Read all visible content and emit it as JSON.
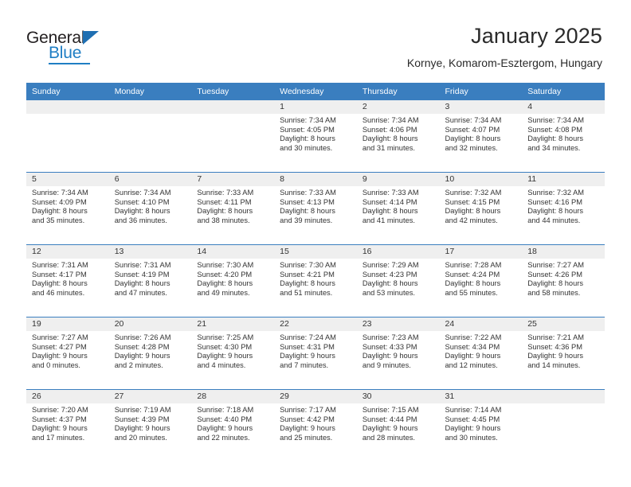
{
  "logo": {
    "word_general": "General",
    "word_blue": "Blue",
    "triangle_color": "#1f6fb2",
    "blue_color": "#1f7ec4"
  },
  "header": {
    "title": "January 2025",
    "subtitle": "Kornye, Komarom-Esztergom, Hungary",
    "header_bg": "#3a7ebf",
    "daynum_bg": "#efefef"
  },
  "weekday_headers": [
    "Sunday",
    "Monday",
    "Tuesday",
    "Wednesday",
    "Thursday",
    "Friday",
    "Saturday"
  ],
  "weeks": [
    [
      {
        "empty": true
      },
      {
        "empty": true
      },
      {
        "empty": true
      },
      {
        "day": "1",
        "sunrise": "Sunrise: 7:34 AM",
        "sunset": "Sunset: 4:05 PM",
        "daylight1": "Daylight: 8 hours",
        "daylight2": "and 30 minutes."
      },
      {
        "day": "2",
        "sunrise": "Sunrise: 7:34 AM",
        "sunset": "Sunset: 4:06 PM",
        "daylight1": "Daylight: 8 hours",
        "daylight2": "and 31 minutes."
      },
      {
        "day": "3",
        "sunrise": "Sunrise: 7:34 AM",
        "sunset": "Sunset: 4:07 PM",
        "daylight1": "Daylight: 8 hours",
        "daylight2": "and 32 minutes."
      },
      {
        "day": "4",
        "sunrise": "Sunrise: 7:34 AM",
        "sunset": "Sunset: 4:08 PM",
        "daylight1": "Daylight: 8 hours",
        "daylight2": "and 34 minutes."
      }
    ],
    [
      {
        "day": "5",
        "sunrise": "Sunrise: 7:34 AM",
        "sunset": "Sunset: 4:09 PM",
        "daylight1": "Daylight: 8 hours",
        "daylight2": "and 35 minutes."
      },
      {
        "day": "6",
        "sunrise": "Sunrise: 7:34 AM",
        "sunset": "Sunset: 4:10 PM",
        "daylight1": "Daylight: 8 hours",
        "daylight2": "and 36 minutes."
      },
      {
        "day": "7",
        "sunrise": "Sunrise: 7:33 AM",
        "sunset": "Sunset: 4:11 PM",
        "daylight1": "Daylight: 8 hours",
        "daylight2": "and 38 minutes."
      },
      {
        "day": "8",
        "sunrise": "Sunrise: 7:33 AM",
        "sunset": "Sunset: 4:13 PM",
        "daylight1": "Daylight: 8 hours",
        "daylight2": "and 39 minutes."
      },
      {
        "day": "9",
        "sunrise": "Sunrise: 7:33 AM",
        "sunset": "Sunset: 4:14 PM",
        "daylight1": "Daylight: 8 hours",
        "daylight2": "and 41 minutes."
      },
      {
        "day": "10",
        "sunrise": "Sunrise: 7:32 AM",
        "sunset": "Sunset: 4:15 PM",
        "daylight1": "Daylight: 8 hours",
        "daylight2": "and 42 minutes."
      },
      {
        "day": "11",
        "sunrise": "Sunrise: 7:32 AM",
        "sunset": "Sunset: 4:16 PM",
        "daylight1": "Daylight: 8 hours",
        "daylight2": "and 44 minutes."
      }
    ],
    [
      {
        "day": "12",
        "sunrise": "Sunrise: 7:31 AM",
        "sunset": "Sunset: 4:17 PM",
        "daylight1": "Daylight: 8 hours",
        "daylight2": "and 46 minutes."
      },
      {
        "day": "13",
        "sunrise": "Sunrise: 7:31 AM",
        "sunset": "Sunset: 4:19 PM",
        "daylight1": "Daylight: 8 hours",
        "daylight2": "and 47 minutes."
      },
      {
        "day": "14",
        "sunrise": "Sunrise: 7:30 AM",
        "sunset": "Sunset: 4:20 PM",
        "daylight1": "Daylight: 8 hours",
        "daylight2": "and 49 minutes."
      },
      {
        "day": "15",
        "sunrise": "Sunrise: 7:30 AM",
        "sunset": "Sunset: 4:21 PM",
        "daylight1": "Daylight: 8 hours",
        "daylight2": "and 51 minutes."
      },
      {
        "day": "16",
        "sunrise": "Sunrise: 7:29 AM",
        "sunset": "Sunset: 4:23 PM",
        "daylight1": "Daylight: 8 hours",
        "daylight2": "and 53 minutes."
      },
      {
        "day": "17",
        "sunrise": "Sunrise: 7:28 AM",
        "sunset": "Sunset: 4:24 PM",
        "daylight1": "Daylight: 8 hours",
        "daylight2": "and 55 minutes."
      },
      {
        "day": "18",
        "sunrise": "Sunrise: 7:27 AM",
        "sunset": "Sunset: 4:26 PM",
        "daylight1": "Daylight: 8 hours",
        "daylight2": "and 58 minutes."
      }
    ],
    [
      {
        "day": "19",
        "sunrise": "Sunrise: 7:27 AM",
        "sunset": "Sunset: 4:27 PM",
        "daylight1": "Daylight: 9 hours",
        "daylight2": "and 0 minutes."
      },
      {
        "day": "20",
        "sunrise": "Sunrise: 7:26 AM",
        "sunset": "Sunset: 4:28 PM",
        "daylight1": "Daylight: 9 hours",
        "daylight2": "and 2 minutes."
      },
      {
        "day": "21",
        "sunrise": "Sunrise: 7:25 AM",
        "sunset": "Sunset: 4:30 PM",
        "daylight1": "Daylight: 9 hours",
        "daylight2": "and 4 minutes."
      },
      {
        "day": "22",
        "sunrise": "Sunrise: 7:24 AM",
        "sunset": "Sunset: 4:31 PM",
        "daylight1": "Daylight: 9 hours",
        "daylight2": "and 7 minutes."
      },
      {
        "day": "23",
        "sunrise": "Sunrise: 7:23 AM",
        "sunset": "Sunset: 4:33 PM",
        "daylight1": "Daylight: 9 hours",
        "daylight2": "and 9 minutes."
      },
      {
        "day": "24",
        "sunrise": "Sunrise: 7:22 AM",
        "sunset": "Sunset: 4:34 PM",
        "daylight1": "Daylight: 9 hours",
        "daylight2": "and 12 minutes."
      },
      {
        "day": "25",
        "sunrise": "Sunrise: 7:21 AM",
        "sunset": "Sunset: 4:36 PM",
        "daylight1": "Daylight: 9 hours",
        "daylight2": "and 14 minutes."
      }
    ],
    [
      {
        "day": "26",
        "sunrise": "Sunrise: 7:20 AM",
        "sunset": "Sunset: 4:37 PM",
        "daylight1": "Daylight: 9 hours",
        "daylight2": "and 17 minutes."
      },
      {
        "day": "27",
        "sunrise": "Sunrise: 7:19 AM",
        "sunset": "Sunset: 4:39 PM",
        "daylight1": "Daylight: 9 hours",
        "daylight2": "and 20 minutes."
      },
      {
        "day": "28",
        "sunrise": "Sunrise: 7:18 AM",
        "sunset": "Sunset: 4:40 PM",
        "daylight1": "Daylight: 9 hours",
        "daylight2": "and 22 minutes."
      },
      {
        "day": "29",
        "sunrise": "Sunrise: 7:17 AM",
        "sunset": "Sunset: 4:42 PM",
        "daylight1": "Daylight: 9 hours",
        "daylight2": "and 25 minutes."
      },
      {
        "day": "30",
        "sunrise": "Sunrise: 7:15 AM",
        "sunset": "Sunset: 4:44 PM",
        "daylight1": "Daylight: 9 hours",
        "daylight2": "and 28 minutes."
      },
      {
        "day": "31",
        "sunrise": "Sunrise: 7:14 AM",
        "sunset": "Sunset: 4:45 PM",
        "daylight1": "Daylight: 9 hours",
        "daylight2": "and 30 minutes."
      },
      {
        "empty": true
      }
    ]
  ]
}
